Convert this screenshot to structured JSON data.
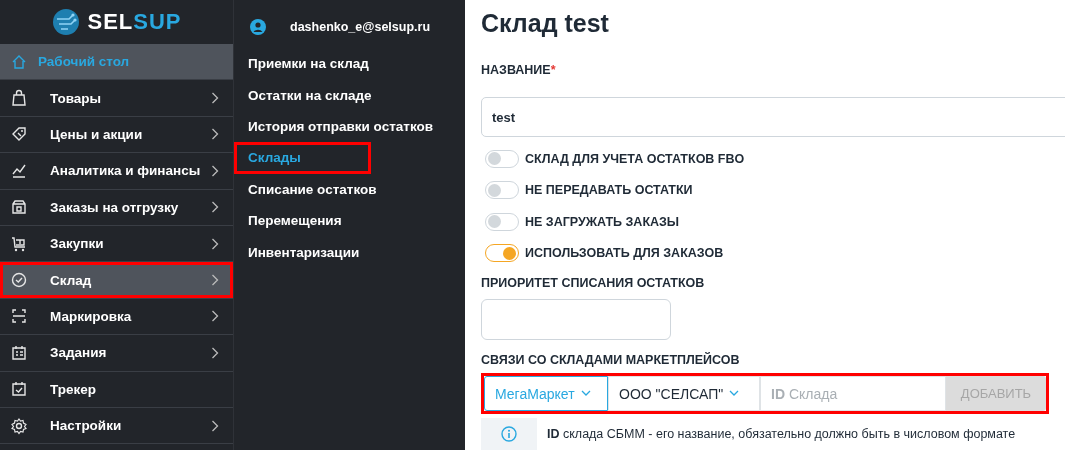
{
  "logo": {
    "parts": [
      {
        "text": "SEL",
        "color": "#ffffff"
      },
      {
        "text": "SUP",
        "color": "#29a8e0"
      }
    ]
  },
  "sidebar": {
    "items": [
      {
        "label": "Рабочий стол",
        "selected": true,
        "expandable": false,
        "highlighted": false,
        "home": true
      },
      {
        "label": "Товары",
        "selected": false,
        "expandable": true,
        "highlighted": false
      },
      {
        "label": "Цены и акции",
        "selected": false,
        "expandable": true,
        "highlighted": false
      },
      {
        "label": "Аналитика и финансы",
        "selected": false,
        "expandable": true,
        "highlighted": false
      },
      {
        "label": "Заказы на отгрузку",
        "selected": false,
        "expandable": true,
        "highlighted": false
      },
      {
        "label": "Закупки",
        "selected": false,
        "expandable": true,
        "highlighted": false
      },
      {
        "label": "Склад",
        "selected": true,
        "expandable": true,
        "highlighted": true
      },
      {
        "label": "Маркировка",
        "selected": false,
        "expandable": true,
        "highlighted": false
      },
      {
        "label": "Задания",
        "selected": false,
        "expandable": true,
        "highlighted": false
      },
      {
        "label": "Трекер",
        "selected": false,
        "expandable": false,
        "highlighted": false
      },
      {
        "label": "Настройки",
        "selected": false,
        "expandable": true,
        "highlighted": false
      }
    ]
  },
  "submenu": {
    "user": "dashenko_e@selsup.ru",
    "items": [
      {
        "label": "Приемки на склад",
        "selected": false,
        "highlighted": false
      },
      {
        "label": "Остатки на складе",
        "selected": false,
        "highlighted": false
      },
      {
        "label": "История отправки остатков",
        "selected": false,
        "highlighted": false
      },
      {
        "label": "Склады",
        "selected": true,
        "highlighted": true
      },
      {
        "label": "Списание остатков",
        "selected": false,
        "highlighted": false
      },
      {
        "label": "Перемещения",
        "selected": false,
        "highlighted": false
      },
      {
        "label": "Инвентаризации",
        "selected": false,
        "highlighted": false
      }
    ]
  },
  "main": {
    "title": "Склад test",
    "name_label": "НАЗВАНИЕ",
    "required_mark": "*",
    "name_value": "test",
    "toggles": [
      {
        "label": "СКЛАД ДЛЯ УЧЕТА ОСТАТКОВ FBO",
        "on": false
      },
      {
        "label": "НЕ ПЕРЕДАВАТЬ ОСТАТКИ",
        "on": false
      },
      {
        "label": "НЕ ЗАГРУЖАТЬ ЗАКАЗЫ",
        "on": false
      },
      {
        "label": "ИСПОЛЬЗОВАТЬ ДЛЯ ЗАКАЗОВ",
        "on": true
      }
    ],
    "priority_label": "ПРИОРИТЕТ СПИСАНИЯ ОСТАТКОВ",
    "links_label": "СВЯЗИ СО СКЛАДАМИ МАРКЕТПЛЕЙСОВ",
    "links_row": {
      "highlighted": true,
      "marketplace": "МегаМаркет",
      "company": "ООО \"СЕЛСАП\"",
      "id_placeholder": "**ID** Склада",
      "add_button": {
        "label": "ДОБАВИТЬ",
        "disabled": true
      }
    },
    "info": "**ID** склада СБММ - его название, обязательно должно быть в числовом формате"
  }
}
